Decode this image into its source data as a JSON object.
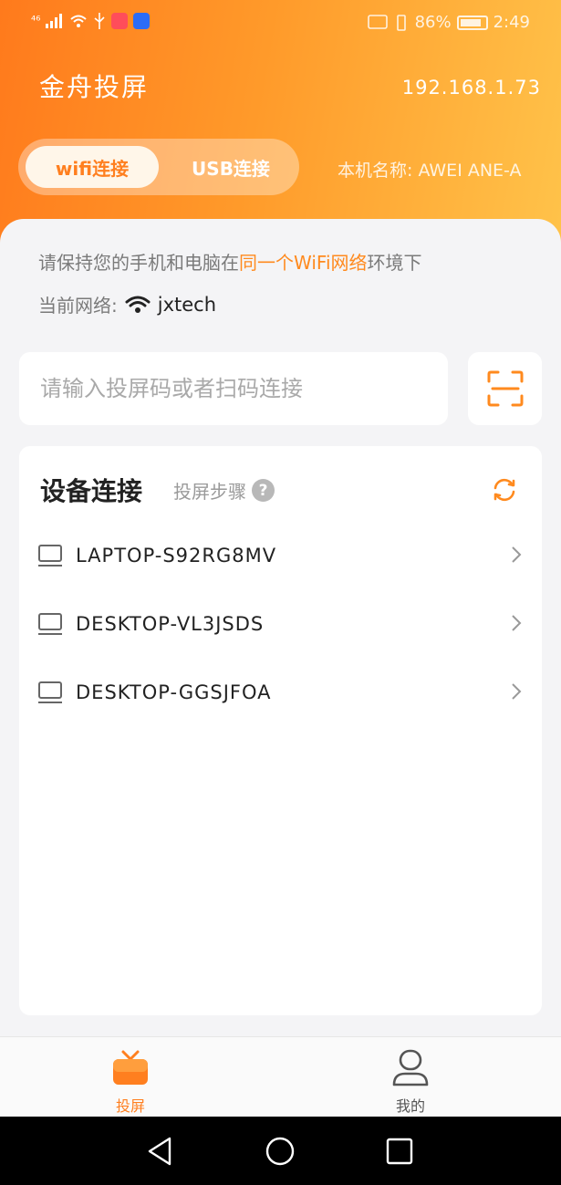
{
  "status_bar": {
    "network_type": "⁴⁶",
    "battery": "86%",
    "time": "2:49"
  },
  "header": {
    "app_title": "金舟投屏",
    "ip_address": "192.168.1.73",
    "tabs": [
      "wifi连接",
      "USB连接"
    ],
    "device_name": "本机名称: AWEI ANE-A"
  },
  "hint": {
    "prefix": "请保持您的手机和电脑在",
    "highlight": "同一个WiFi网络",
    "suffix": "环境下"
  },
  "network": {
    "label": "当前网络:",
    "ssid": "jxtech"
  },
  "connect_input": {
    "placeholder": "请输入投屏码或者扫码连接"
  },
  "device_panel": {
    "title": "设备连接",
    "steps_label": "投屏步骤",
    "help_glyph": "?",
    "devices": [
      "LAPTOP-S92RG8MV",
      "DESKTOP-VL3JSDS",
      "DESKTOP-GGSJFOA"
    ]
  },
  "tabbar": {
    "cast_label": "投屏",
    "mine_label": "我的"
  },
  "colors": {
    "accent": "#ff7f1f",
    "header_start": "#ff7a1c",
    "header_end": "#ffc34a"
  }
}
